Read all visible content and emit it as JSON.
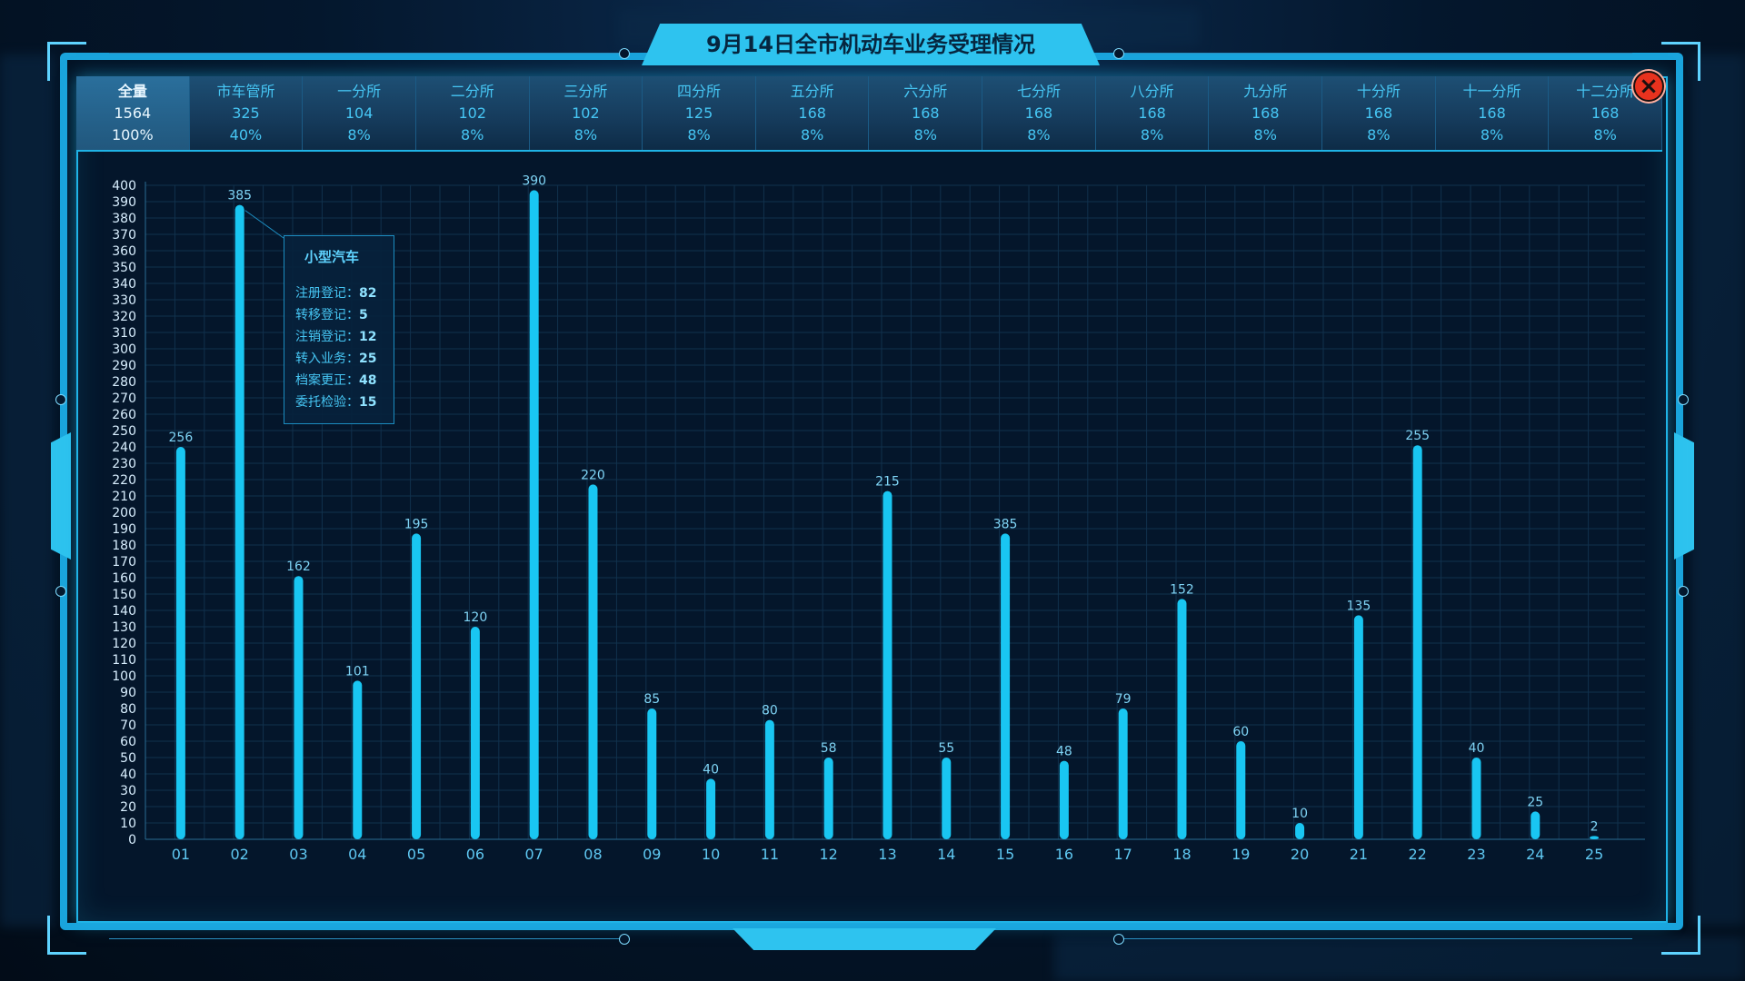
{
  "title": "9月14日全市机动车业务受理情况",
  "close_label": "×",
  "colors": {
    "accent": "#1fb3e6",
    "bar": "#19c6f2",
    "panel": "#04162b",
    "close": "#e8321e"
  },
  "summary": [
    {
      "name": "全量",
      "count": "1564",
      "pct": "100%"
    },
    {
      "name": "市车管所",
      "count": "325",
      "pct": "40%"
    },
    {
      "name": "一分所",
      "count": "104",
      "pct": "8%"
    },
    {
      "name": "二分所",
      "count": "102",
      "pct": "8%"
    },
    {
      "name": "三分所",
      "count": "102",
      "pct": "8%"
    },
    {
      "name": "四分所",
      "count": "125",
      "pct": "8%"
    },
    {
      "name": "五分所",
      "count": "168",
      "pct": "8%"
    },
    {
      "name": "六分所",
      "count": "168",
      "pct": "8%"
    },
    {
      "name": "七分所",
      "count": "168",
      "pct": "8%"
    },
    {
      "name": "八分所",
      "count": "168",
      "pct": "8%"
    },
    {
      "name": "九分所",
      "count": "168",
      "pct": "8%"
    },
    {
      "name": "十分所",
      "count": "168",
      "pct": "8%"
    },
    {
      "name": "十一分所",
      "count": "168",
      "pct": "8%"
    },
    {
      "name": "十二分所",
      "count": "168",
      "pct": "8%"
    }
  ],
  "tooltip": {
    "title": "小型汽车",
    "rows": [
      {
        "label": "注册登记：",
        "value": "82"
      },
      {
        "label": "转移登记：",
        "value": "5"
      },
      {
        "label": "注销登记：",
        "value": "12"
      },
      {
        "label": "转入业务：",
        "value": "25"
      },
      {
        "label": "档案更正：",
        "value": "48"
      },
      {
        "label": "委托检验：",
        "value": "15"
      }
    ]
  },
  "chart_data": {
    "type": "bar",
    "categories": [
      "01",
      "02",
      "03",
      "04",
      "05",
      "06",
      "07",
      "08",
      "09",
      "10",
      "11",
      "12",
      "13",
      "14",
      "15",
      "16",
      "17",
      "18",
      "19",
      "20",
      "21",
      "22",
      "23",
      "24",
      "25"
    ],
    "values": [
      240,
      388,
      161,
      97,
      187,
      130,
      397,
      217,
      80,
      37,
      73,
      50,
      213,
      50,
      187,
      48,
      80,
      147,
      60,
      10,
      137,
      241,
      50,
      17,
      2
    ],
    "labels": [
      "256",
      "385",
      "162",
      "101",
      "195",
      "120",
      "390",
      "220",
      "85",
      "40",
      "80",
      "58",
      "215",
      "55",
      "385",
      "48",
      "79",
      "152",
      "60",
      "10",
      "135",
      "255",
      "40",
      "25",
      "2"
    ],
    "ylim": [
      0,
      400
    ],
    "ytick_step": 10,
    "grid": true
  }
}
